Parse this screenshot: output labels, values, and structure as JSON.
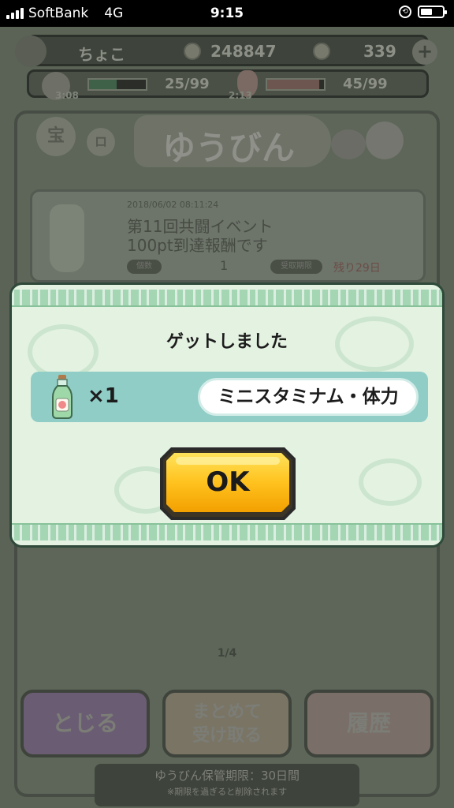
{
  "status_bar": {
    "carrier": "SoftBank",
    "network": "4G",
    "time": "9:15"
  },
  "hud": {
    "player_name": "ちょこ",
    "money": "248847",
    "gems": "339",
    "stamina": "25/99",
    "power": "45/99",
    "stamina_timer": "3:08",
    "power_timer": "2:13",
    "stamina_fill": 0.48,
    "power_fill": 0.92
  },
  "screen": {
    "title": "ゆうびん",
    "tab_a": "宝",
    "tab_b": "ロ"
  },
  "mail_item": {
    "date": "2018/06/02 08:11:24",
    "line1": "第11回共闘イベント",
    "line2": "100pt到達報酬です",
    "qty_tag": "個数",
    "qty": "1",
    "expire_tag": "受取期限",
    "expire": "残り29日"
  },
  "page_indicator": "1/4",
  "buttons": {
    "close": "とじる",
    "bulk": "まとめて\n受け取る",
    "history": "履歴"
  },
  "footer": {
    "line1": "ゆうびん保管期限：30日間",
    "line2": "※期限を過ぎると削除されます"
  },
  "dialog": {
    "title": "ゲットしました",
    "count": "×1",
    "item_name": "ミニスタミナム・体力",
    "ok_label": "OK"
  },
  "colors": {
    "ok_yellow": "#f6b21a",
    "dialog_bg": "#e4f2e2",
    "item_row": "#8fcdc6"
  }
}
